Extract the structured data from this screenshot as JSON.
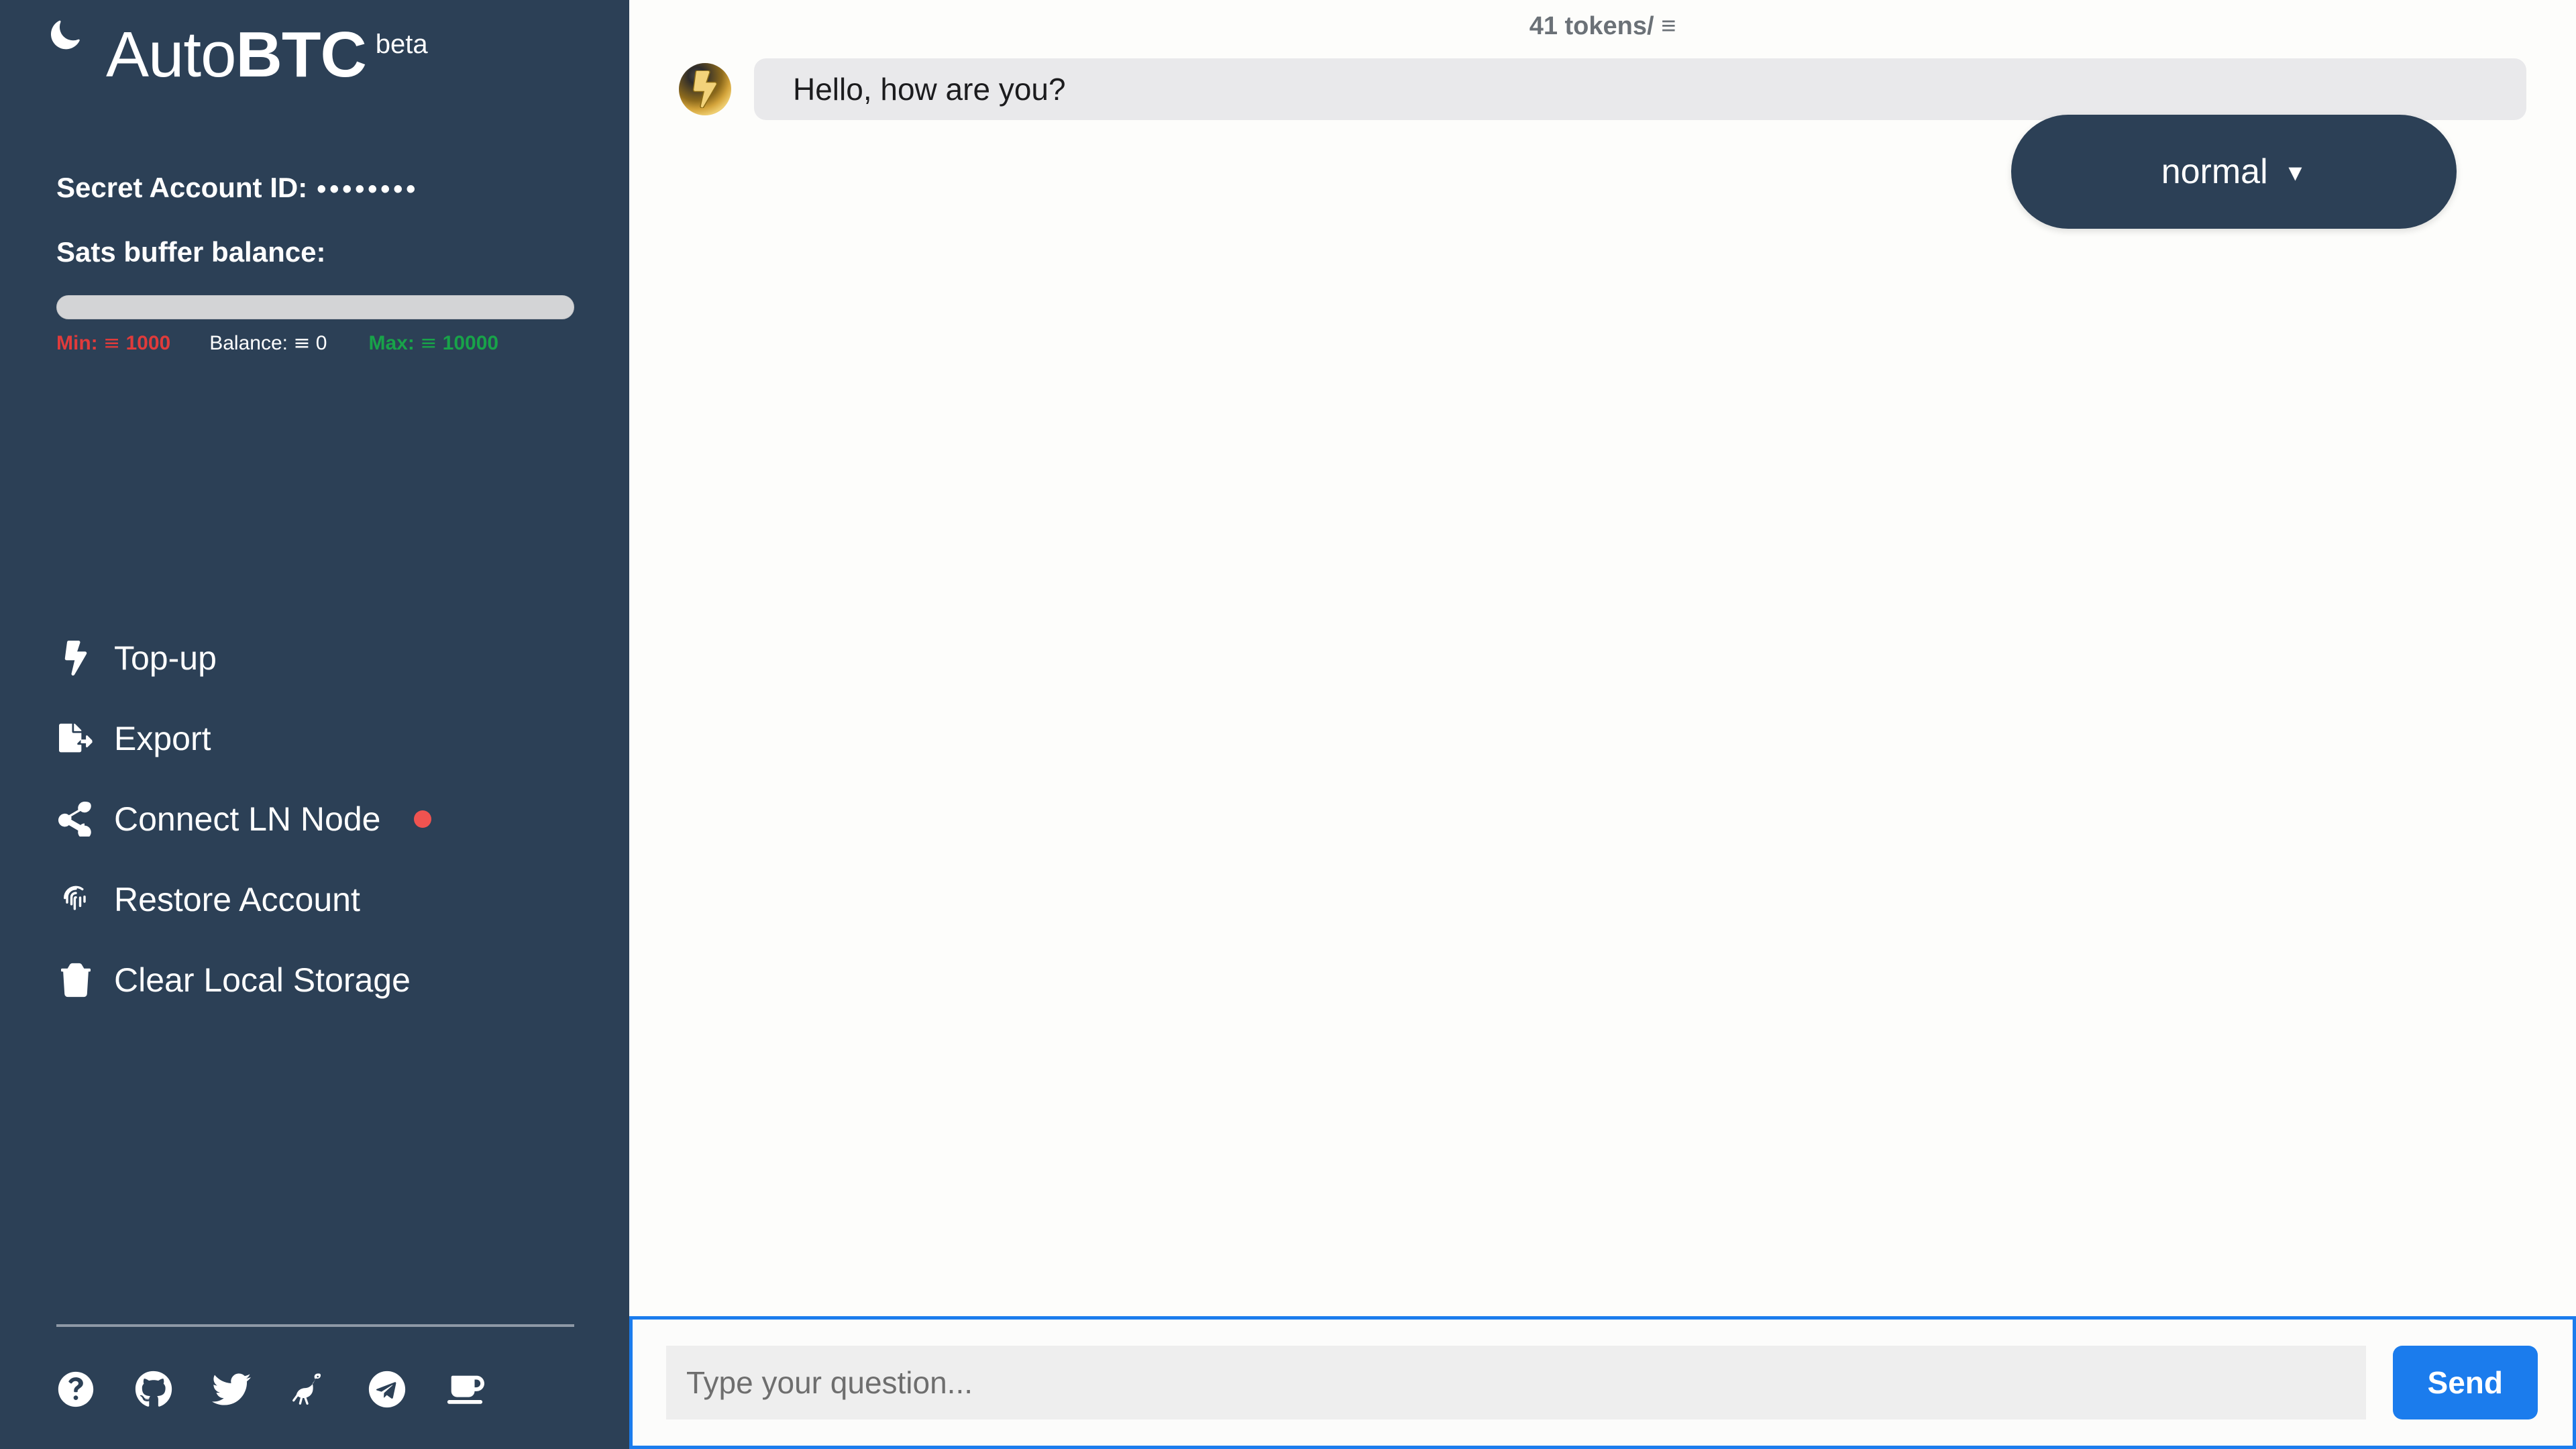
{
  "brand": {
    "name_light": "Auto",
    "name_bold": "BTC",
    "tag": "beta",
    "theme_toggle_icon": "moon-icon"
  },
  "account": {
    "id_label": "Secret Account ID:",
    "id_masked": "••••••••",
    "sats_label": "Sats buffer balance:",
    "buffer_fill_percent": 0,
    "min_label": "Min:",
    "min_value": "1000",
    "balance_label": "Balance:",
    "balance_value": "0",
    "max_label": "Max:",
    "max_value": "10000",
    "sat_symbol": "≡",
    "min_color": "#e03b3b",
    "max_color": "#18a349"
  },
  "nav": {
    "items": [
      {
        "label": "Top-up",
        "icon": "bolt-icon",
        "badge": null
      },
      {
        "label": "Export",
        "icon": "file-export-icon",
        "badge": null
      },
      {
        "label": "Connect LN Node",
        "icon": "share-nodes-icon",
        "badge": "offline-dot"
      },
      {
        "label": "Restore Account",
        "icon": "fingerprint-icon",
        "badge": null
      },
      {
        "label": "Clear Local Storage",
        "icon": "trash-icon",
        "badge": null
      }
    ]
  },
  "social": {
    "items": [
      {
        "name": "help-icon"
      },
      {
        "name": "github-icon"
      },
      {
        "name": "twitter-icon"
      },
      {
        "name": "nostr-ostrich-icon"
      },
      {
        "name": "telegram-icon"
      },
      {
        "name": "coffee-icon"
      }
    ]
  },
  "main": {
    "token_meter": "41 tokens/ ≡",
    "mode": {
      "selected": "normal",
      "caret": "▼"
    },
    "messages": [
      {
        "author": "assistant",
        "avatar": "lightning-avatar-icon",
        "text": "Hello, how are you?"
      }
    ]
  },
  "composer": {
    "placeholder": "Type your question...",
    "value": "",
    "send_label": "Send",
    "accent_color": "#1b7ced"
  },
  "theme": {
    "sidebar_bg": "#2c4056",
    "main_bg": "#fdfdfb",
    "bubble_bg": "#e9e9eb"
  }
}
